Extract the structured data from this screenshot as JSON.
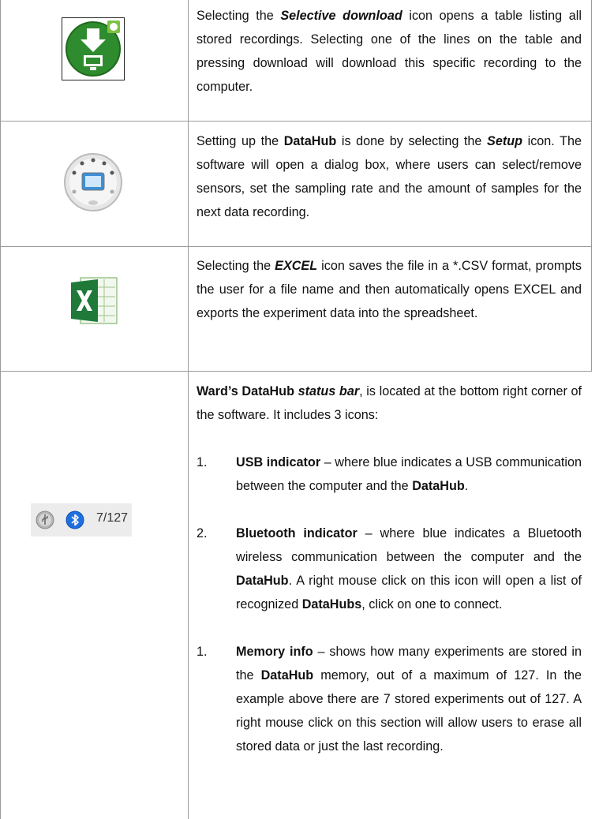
{
  "rows": [
    {
      "icon": "selective-download-icon",
      "text_start": "Selecting the ",
      "bold_italic": "Selective download",
      "text_rest": " icon opens a table listing all stored recordings. Selecting one of the lines on the table and pressing download will download this specific recording to the computer."
    },
    {
      "icon": "datahub-setup-icon",
      "text_start": "Setting up the ",
      "bold": "DataHub",
      "text_mid": " is done by selecting the ",
      "bold_italic": "Setup",
      "text_rest": " icon. The software will open a dialog box, where users can select/remove sensors, set the sampling rate and the amount of samples for the next data recording."
    },
    {
      "icon": "excel-icon",
      "text_start": "Selecting the ",
      "bold_italic": "EXCEL",
      "text_rest": " icon saves the file in a *.CSV format, prompts the user for a file name and then automatically opens EXCEL and exports the experiment data into the spreadsheet."
    },
    {
      "icon": "status-bar-icon",
      "status_text": "7/127",
      "intro_bold": "Ward’s DataHub ",
      "intro_bold_italic": "status bar",
      "intro_rest": ", is located at the bottom right corner of the software. It includes 3 icons:",
      "items": [
        {
          "num": "1.",
          "bold": "USB indicator",
          "text1": " – where blue indicates a USB communication between the computer and the ",
          "bold2": "DataHub",
          "text2": "."
        },
        {
          "num": "2.",
          "bold": "Bluetooth indicator",
          "text1": " – where blue indicates a Bluetooth wireless communication between the computer and the ",
          "bold2": "DataHub",
          "text2": ". A right mouse click on this icon will open a list of recognized ",
          "bold3": "DataHubs",
          "text3": ", click on one to connect."
        },
        {
          "num": "1.",
          "bold": "Memory info",
          "text1": " – shows how many experiments are stored in the ",
          "bold2": "DataHub",
          "text2": " memory, out of a maximum of 127. In the example above there are 7 stored experiments out of 127. A right mouse click on this section will allow users to erase all stored data or just the last recording."
        }
      ]
    }
  ]
}
